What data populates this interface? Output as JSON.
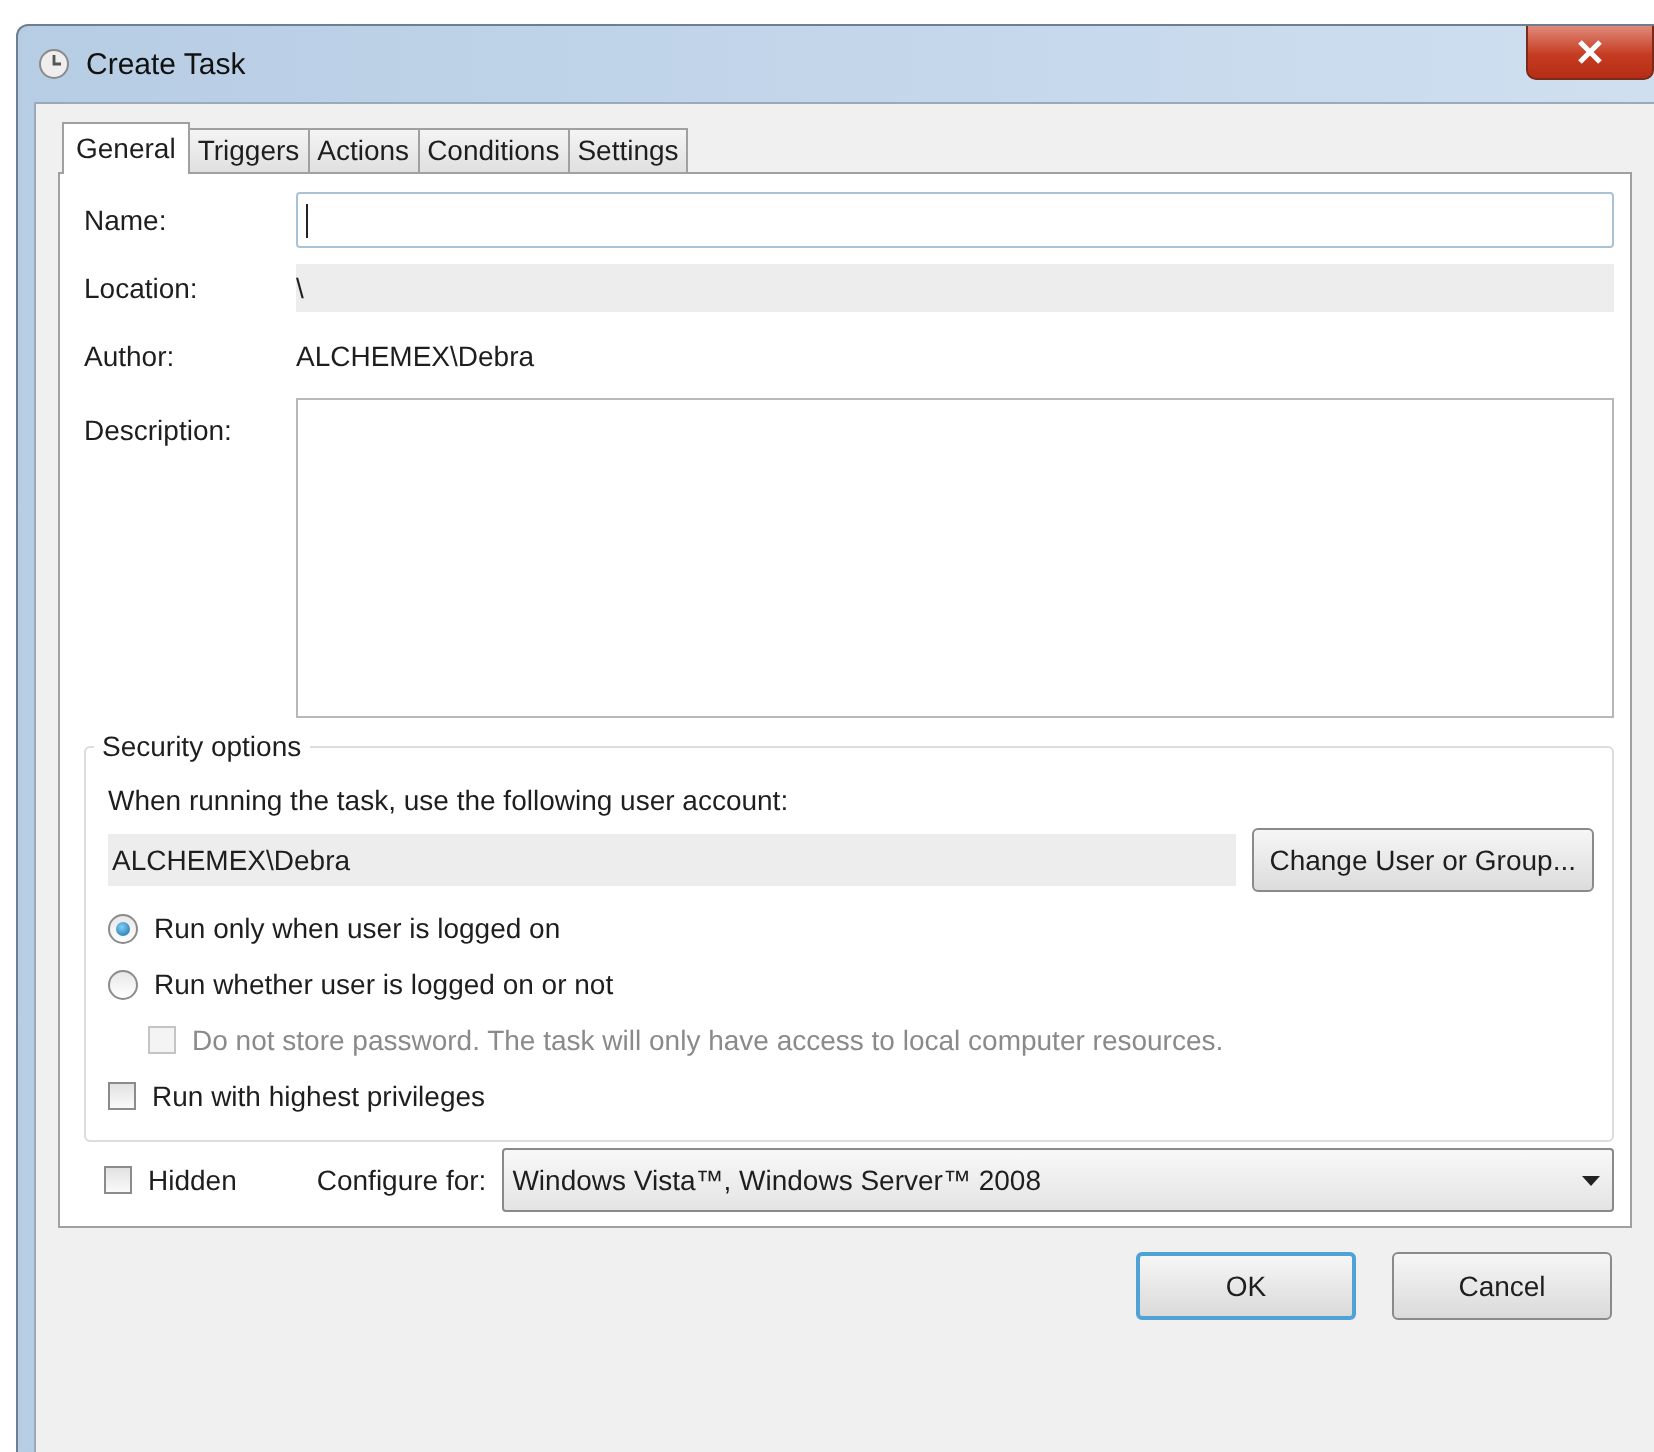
{
  "window": {
    "title": "Create Task"
  },
  "tabs": [
    {
      "label": "General",
      "selected": true
    },
    {
      "label": "Triggers",
      "selected": false
    },
    {
      "label": "Actions",
      "selected": false
    },
    {
      "label": "Conditions",
      "selected": false
    },
    {
      "label": "Settings",
      "selected": false
    }
  ],
  "general": {
    "name": {
      "label": "Name:"
    },
    "location": {
      "label": "Location:",
      "value": "\\"
    },
    "author": {
      "label": "Author:",
      "value": "ALCHEMEX\\Debra"
    },
    "description": {
      "label": "Description:"
    }
  },
  "security": {
    "title": "Security options",
    "prompt": "When running the task, use the following user account:",
    "account": "ALCHEMEX\\Debra",
    "change_button": "Change User or Group...",
    "options": [
      {
        "kind": "radio",
        "label": "Run only when user is logged on",
        "selected": true
      },
      {
        "kind": "radio",
        "label": "Run whether user is logged on or not",
        "selected": false,
        "children": [
          {
            "kind": "checkbox",
            "label": "Do not store password.  The task will only have access to local computer resources.",
            "checked": false,
            "disabled": true
          }
        ]
      },
      {
        "kind": "checkbox",
        "label": "Run with highest privileges",
        "checked": false,
        "disabled": false
      }
    ]
  },
  "hidden": {
    "label": "Hidden",
    "checked": false
  },
  "configure": {
    "label": "Configure for:",
    "value": "Windows Vista™, Windows Server™ 2008"
  },
  "buttons": [
    {
      "label": "OK",
      "default": true
    },
    {
      "label": "Cancel",
      "default": false
    }
  ]
}
